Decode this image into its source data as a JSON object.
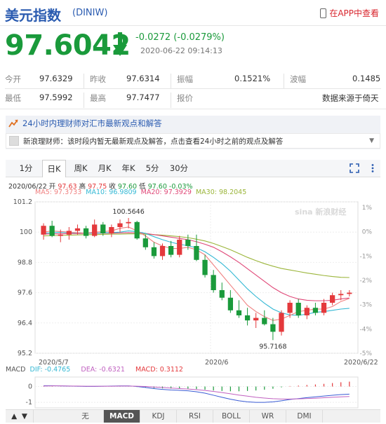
{
  "header": {
    "title": "美元指数",
    "code": "(DINIW)",
    "app_link": "在APP中查看"
  },
  "quote": {
    "price": "97.6042",
    "change": "-0.0272 (-0.0279%)",
    "time": "2020-06-22 09:14:13"
  },
  "stats": {
    "row1": [
      {
        "label": "今开",
        "value": "97.6329"
      },
      {
        "label": "昨收",
        "value": "97.6314"
      },
      {
        "label": "振幅",
        "value": "0.1521%"
      },
      {
        "label": "波幅",
        "value": "0.1485"
      }
    ],
    "row2": [
      {
        "label": "最低",
        "value": "97.5992"
      },
      {
        "label": "最高",
        "value": "97.7477"
      },
      {
        "label": "报价",
        "value": "数据来源于倚天"
      }
    ]
  },
  "news": {
    "headline": "24小时内理财师对汇市最新观点和解答",
    "line": "新浪理财师：该时段内暂无最新观点及解答，点击查看24小时之前的观点及解答"
  },
  "tabs": [
    "1分",
    "日K",
    "周K",
    "月K",
    "年K",
    "5分",
    "30分"
  ],
  "active_tab": "日K",
  "kline_info": {
    "date": "2020/06/22",
    "open_label": "开",
    "open": "97.63",
    "high_label": "高",
    "high": "97.75",
    "close_label": "收",
    "close": "97.60",
    "low_label": "低",
    "low": "97.60",
    "pct": "-0.03%",
    "ma5": "MA5: 97.3733",
    "ma10": "MA10: 96.9809",
    "ma20": "MA20: 97.3929",
    "ma30": "MA30: 98.2045"
  },
  "macd_info": {
    "label": "MACD",
    "dif": "DIF: -0.4765",
    "dea": "DEA: -0.6321",
    "macd": "MACD: 0.3112"
  },
  "watermark": "sina 新浪财经",
  "bottom_tabs": [
    "无",
    "MACD",
    "KDJ",
    "RSI",
    "BOLL",
    "WR",
    "DMI"
  ],
  "active_bottom_tab": "MACD",
  "colors": {
    "up": "#e4393c",
    "down": "#1a9a3b",
    "ma5": "#f08080",
    "ma10": "#33b8d4",
    "ma20": "#e04878",
    "ma30": "#9bb53a"
  },
  "chart_data": [
    {
      "type": "candlestick",
      "title": "",
      "y_ticks": [
        "101.2",
        "100",
        "98.8",
        "97.6",
        "96.4",
        "95.2"
      ],
      "y_tick_values": [
        101.2,
        100,
        98.8,
        97.6,
        96.4,
        95.2
      ],
      "pct_ticks": [
        "1%",
        "0%",
        "-1%",
        "-2%",
        "-3%",
        "-4%",
        "-5%"
      ],
      "x_ticks": [
        "2020/5/7",
        "2020/6",
        "2020/6/22"
      ],
      "ylim": [
        95.2,
        101.2
      ],
      "annotations": [
        {
          "text": "100.5646",
          "value": 100.5646
        },
        {
          "text": "95.7168",
          "value": 95.7168
        }
      ],
      "candles": [
        {
          "o": 99.9,
          "h": 100.35,
          "l": 99.7,
          "c": 100.25
        },
        {
          "o": 100.25,
          "h": 100.45,
          "l": 99.8,
          "c": 99.85
        },
        {
          "o": 99.85,
          "h": 100.1,
          "l": 99.6,
          "c": 99.9
        },
        {
          "o": 99.9,
          "h": 100.2,
          "l": 99.7,
          "c": 100.05
        },
        {
          "o": 100.05,
          "h": 100.3,
          "l": 99.9,
          "c": 100.15
        },
        {
          "o": 100.15,
          "h": 100.25,
          "l": 99.75,
          "c": 99.85
        },
        {
          "o": 99.85,
          "h": 100.5,
          "l": 99.8,
          "c": 100.3
        },
        {
          "o": 100.3,
          "h": 100.4,
          "l": 99.85,
          "c": 99.95
        },
        {
          "o": 99.95,
          "h": 100.3,
          "l": 99.8,
          "c": 100.2
        },
        {
          "o": 100.2,
          "h": 100.5,
          "l": 100.0,
          "c": 100.35
        },
        {
          "o": 100.35,
          "h": 100.56,
          "l": 100.15,
          "c": 100.4
        },
        {
          "o": 100.4,
          "h": 100.45,
          "l": 99.7,
          "c": 99.75
        },
        {
          "o": 99.75,
          "h": 99.9,
          "l": 99.3,
          "c": 99.4
        },
        {
          "o": 99.4,
          "h": 99.6,
          "l": 98.95,
          "c": 99.05
        },
        {
          "o": 99.05,
          "h": 99.55,
          "l": 98.9,
          "c": 99.45
        },
        {
          "o": 99.45,
          "h": 99.65,
          "l": 99.0,
          "c": 99.1
        },
        {
          "o": 99.1,
          "h": 99.85,
          "l": 99.0,
          "c": 99.7
        },
        {
          "o": 99.7,
          "h": 99.9,
          "l": 99.3,
          "c": 99.45
        },
        {
          "o": 99.45,
          "h": 99.9,
          "l": 98.85,
          "c": 98.9
        },
        {
          "o": 98.9,
          "h": 99.1,
          "l": 98.2,
          "c": 98.3
        },
        {
          "o": 98.3,
          "h": 98.5,
          "l": 97.6,
          "c": 97.7
        },
        {
          "o": 97.7,
          "h": 98.0,
          "l": 97.3,
          "c": 97.4
        },
        {
          "o": 97.4,
          "h": 97.7,
          "l": 96.8,
          "c": 96.9
        },
        {
          "o": 96.9,
          "h": 97.3,
          "l": 96.6,
          "c": 96.7
        },
        {
          "o": 96.7,
          "h": 97.0,
          "l": 96.3,
          "c": 96.5
        },
        {
          "o": 96.5,
          "h": 96.8,
          "l": 96.2,
          "c": 96.6
        },
        {
          "o": 96.6,
          "h": 96.9,
          "l": 96.3,
          "c": 96.35
        },
        {
          "o": 96.35,
          "h": 96.6,
          "l": 95.72,
          "c": 96.05
        },
        {
          "o": 96.05,
          "h": 96.9,
          "l": 95.9,
          "c": 96.8
        },
        {
          "o": 96.8,
          "h": 97.3,
          "l": 96.6,
          "c": 97.2
        },
        {
          "o": 97.2,
          "h": 97.35,
          "l": 96.6,
          "c": 96.7
        },
        {
          "o": 96.7,
          "h": 97.1,
          "l": 96.55,
          "c": 97.0
        },
        {
          "o": 97.0,
          "h": 97.2,
          "l": 96.7,
          "c": 96.8
        },
        {
          "o": 96.8,
          "h": 97.35,
          "l": 96.7,
          "c": 97.2
        },
        {
          "o": 97.2,
          "h": 97.6,
          "l": 97.1,
          "c": 97.5
        },
        {
          "o": 97.5,
          "h": 97.7,
          "l": 97.3,
          "c": 97.55
        },
        {
          "o": 97.55,
          "h": 97.7,
          "l": 97.45,
          "c": 97.6
        }
      ],
      "ma5": [
        100.0,
        100.05,
        100.02,
        100.0,
        99.98,
        99.96,
        100.0,
        100.02,
        100.05,
        100.15,
        100.2,
        100.05,
        99.85,
        99.6,
        99.45,
        99.35,
        99.35,
        99.4,
        99.3,
        99.1,
        98.7,
        98.3,
        97.9,
        97.5,
        97.1,
        96.85,
        96.65,
        96.5,
        96.55,
        96.7,
        96.85,
        96.9,
        96.95,
        96.95,
        97.05,
        97.25,
        97.37
      ],
      "ma10": [
        99.95,
        99.98,
        99.99,
        99.98,
        99.97,
        99.96,
        99.96,
        99.97,
        99.98,
        100.0,
        100.05,
        100.02,
        99.95,
        99.82,
        99.7,
        99.6,
        99.52,
        99.46,
        99.38,
        99.22,
        99.0,
        98.75,
        98.45,
        98.1,
        97.75,
        97.45,
        97.18,
        96.95,
        96.8,
        96.72,
        96.7,
        96.75,
        96.82,
        96.85,
        96.9,
        96.95,
        96.98
      ],
      "ma20": [
        99.92,
        99.93,
        99.93,
        99.94,
        99.94,
        99.95,
        99.95,
        99.96,
        99.96,
        99.97,
        99.98,
        99.97,
        99.95,
        99.9,
        99.85,
        99.8,
        99.75,
        99.7,
        99.62,
        99.52,
        99.4,
        99.22,
        99.02,
        98.8,
        98.55,
        98.3,
        98.05,
        97.8,
        97.6,
        97.45,
        97.35,
        97.3,
        97.28,
        97.28,
        97.3,
        97.35,
        97.39
      ],
      "ma30": [
        99.85,
        99.86,
        99.87,
        99.88,
        99.89,
        99.9,
        99.9,
        99.91,
        99.92,
        99.92,
        99.93,
        99.93,
        99.92,
        99.9,
        99.88,
        99.85,
        99.82,
        99.78,
        99.72,
        99.65,
        99.55,
        99.43,
        99.3,
        99.15,
        99.0,
        98.87,
        98.75,
        98.65,
        98.56,
        98.5,
        98.44,
        98.38,
        98.33,
        98.28,
        98.24,
        98.21,
        98.2
      ]
    },
    {
      "type": "bar",
      "title": "MACD",
      "y_ticks": [
        "0",
        "-1"
      ],
      "ylim": [
        -1.35,
        0.6
      ],
      "macd_bars": [
        0.02,
        0.02,
        0.01,
        0.01,
        0.0,
        -0.01,
        0.0,
        0.01,
        0.02,
        0.02,
        0.01,
        -0.03,
        -0.06,
        -0.1,
        -0.12,
        -0.13,
        -0.12,
        -0.13,
        -0.16,
        -0.2,
        -0.25,
        -0.28,
        -0.3,
        -0.3,
        -0.28,
        -0.25,
        -0.2,
        -0.14,
        -0.05,
        0.03,
        0.06,
        0.1,
        0.13,
        0.17,
        0.22,
        0.27,
        0.31
      ],
      "dif": [
        0.05,
        0.05,
        0.04,
        0.03,
        0.02,
        0.01,
        0.01,
        0.02,
        0.03,
        0.04,
        0.04,
        0.0,
        -0.06,
        -0.13,
        -0.18,
        -0.22,
        -0.24,
        -0.27,
        -0.33,
        -0.42,
        -0.55,
        -0.68,
        -0.8,
        -0.9,
        -0.97,
        -1.0,
        -1.0,
        -0.97,
        -0.9,
        -0.82,
        -0.76,
        -0.7,
        -0.65,
        -0.6,
        -0.55,
        -0.51,
        -0.48
      ],
      "dea": [
        0.03,
        0.04,
        0.04,
        0.03,
        0.03,
        0.02,
        0.02,
        0.02,
        0.02,
        0.03,
        0.03,
        0.02,
        0.0,
        -0.03,
        -0.06,
        -0.1,
        -0.13,
        -0.16,
        -0.2,
        -0.25,
        -0.31,
        -0.38,
        -0.46,
        -0.54,
        -0.61,
        -0.68,
        -0.73,
        -0.77,
        -0.79,
        -0.79,
        -0.78,
        -0.76,
        -0.74,
        -0.71,
        -0.68,
        -0.65,
        -0.63
      ]
    }
  ]
}
